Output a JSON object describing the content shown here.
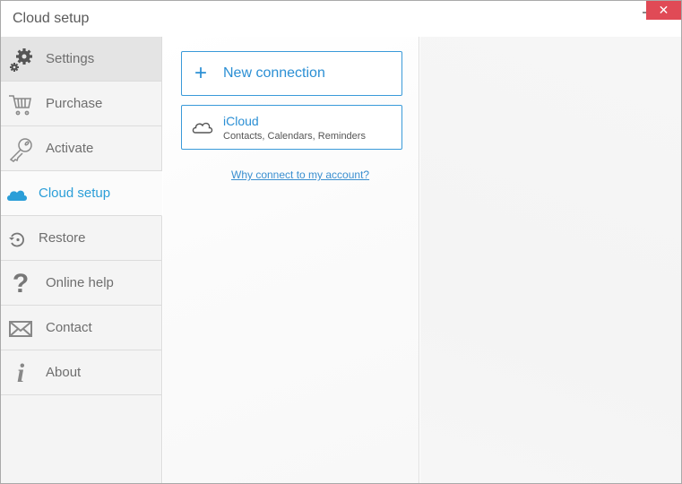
{
  "window": {
    "title": "Cloud setup",
    "minimize_icon": "minimize-icon",
    "close_icon": "close-icon",
    "close_glyph": "✕",
    "close_color": "#e04a56"
  },
  "sidebar": {
    "items": [
      {
        "label": "Settings",
        "icon": "gears-icon",
        "state": "hover"
      },
      {
        "label": "Purchase",
        "icon": "cart-icon"
      },
      {
        "label": "Activate",
        "icon": "key-icon"
      },
      {
        "label": "Cloud setup",
        "icon": "cloud-icon",
        "state": "active"
      },
      {
        "label": "Restore",
        "icon": "restore-icon"
      },
      {
        "label": "Online help",
        "icon": "question-icon"
      },
      {
        "label": "Contact",
        "icon": "envelope-icon"
      },
      {
        "label": "About",
        "icon": "info-icon"
      }
    ],
    "active_color": "#2b9ed8"
  },
  "main": {
    "new_connection": {
      "icon": "plus-icon",
      "label": "New connection"
    },
    "connections": [
      {
        "icon": "cloud-outline-icon",
        "title": "iCloud",
        "subtitle": "Contacts, Calendars, Reminders"
      }
    ],
    "help_link": "Why connect to my account?",
    "accent_color": "#2b8fd4"
  }
}
